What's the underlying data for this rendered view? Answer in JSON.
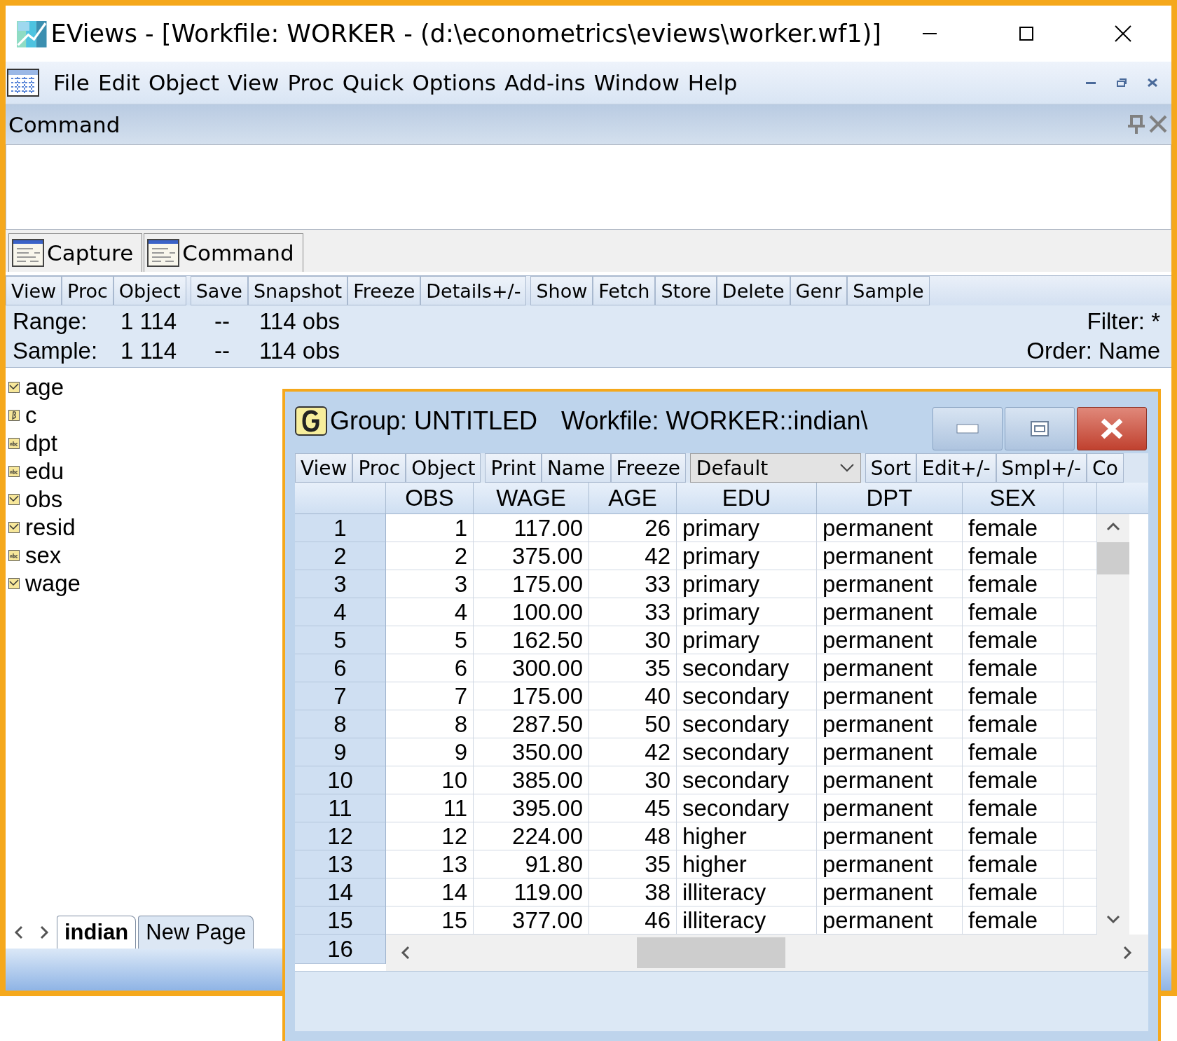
{
  "window": {
    "title": "EViews - [Workfile: WORKER - (d:\\econometrics\\eviews\\worker.wf1)]"
  },
  "menu": [
    "File",
    "Edit",
    "Object",
    "View",
    "Proc",
    "Quick",
    "Options",
    "Add-ins",
    "Window",
    "Help"
  ],
  "command_pane": {
    "title": "Command"
  },
  "pane_tabs": [
    {
      "label": "Capture"
    },
    {
      "label": "Command"
    }
  ],
  "workfile": {
    "toolbar": [
      [
        "View",
        "Proc",
        "Object"
      ],
      [
        "Save",
        "Snapshot",
        "Freeze",
        "Details+/-"
      ],
      [
        "Show",
        "Fetch",
        "Store",
        "Delete",
        "Genr",
        "Sample"
      ]
    ],
    "info": [
      {
        "label": "Range:",
        "start": "1 114",
        "sep": "--",
        "count": "114 obs",
        "right": "Filter: *"
      },
      {
        "label": "Sample:",
        "start": "1 114",
        "sep": "--",
        "count": "114 obs",
        "right": "Order: Name"
      }
    ],
    "objects": [
      {
        "name": "age",
        "kind": "series"
      },
      {
        "name": "c",
        "kind": "coef"
      },
      {
        "name": "dpt",
        "kind": "alpha"
      },
      {
        "name": "edu",
        "kind": "alpha"
      },
      {
        "name": "obs",
        "kind": "series"
      },
      {
        "name": "resid",
        "kind": "series"
      },
      {
        "name": "sex",
        "kind": "alpha"
      },
      {
        "name": "wage",
        "kind": "series"
      }
    ],
    "page_tabs": [
      {
        "label": "indian",
        "selected": true
      },
      {
        "label": "New Page",
        "selected": false
      }
    ]
  },
  "group_window": {
    "title": "Group: UNTITLED",
    "workfile": "Workfile: WORKER::indian\\",
    "toolbar": [
      [
        "View",
        "Proc",
        "Object"
      ],
      [
        "Print",
        "Name",
        "Freeze"
      ]
    ],
    "view_select": "Default",
    "toolbar_right": [
      "Sort",
      "Edit+/-",
      "Smpl+/-",
      "Co"
    ],
    "columns": [
      {
        "label": "OBS",
        "kind": "numeric"
      },
      {
        "label": "WAGE",
        "kind": "numeric"
      },
      {
        "label": "AGE",
        "kind": "numeric"
      },
      {
        "label": "EDU",
        "kind": "text"
      },
      {
        "label": "DPT",
        "kind": "text"
      },
      {
        "label": "SEX",
        "kind": "text"
      }
    ],
    "rows": [
      {
        "label": "1",
        "cells": [
          "1",
          "117.00",
          "26",
          "primary",
          "permanent",
          "female"
        ]
      },
      {
        "label": "2",
        "cells": [
          "2",
          "375.00",
          "42",
          "primary",
          "permanent",
          "female"
        ]
      },
      {
        "label": "3",
        "cells": [
          "3",
          "175.00",
          "33",
          "primary",
          "permanent",
          "female"
        ]
      },
      {
        "label": "4",
        "cells": [
          "4",
          "100.00",
          "33",
          "primary",
          "permanent",
          "female"
        ]
      },
      {
        "label": "5",
        "cells": [
          "5",
          "162.50",
          "30",
          "primary",
          "permanent",
          "female"
        ]
      },
      {
        "label": "6",
        "cells": [
          "6",
          "300.00",
          "35",
          "secondary",
          "permanent",
          "female"
        ]
      },
      {
        "label": "7",
        "cells": [
          "7",
          "175.00",
          "40",
          "secondary",
          "permanent",
          "female"
        ]
      },
      {
        "label": "8",
        "cells": [
          "8",
          "287.50",
          "50",
          "secondary",
          "permanent",
          "female"
        ]
      },
      {
        "label": "9",
        "cells": [
          "9",
          "350.00",
          "42",
          "secondary",
          "permanent",
          "female"
        ]
      },
      {
        "label": "10",
        "cells": [
          "10",
          "385.00",
          "30",
          "secondary",
          "permanent",
          "female"
        ]
      },
      {
        "label": "11",
        "cells": [
          "11",
          "395.00",
          "45",
          "secondary",
          "permanent",
          "female"
        ]
      },
      {
        "label": "12",
        "cells": [
          "12",
          "224.00",
          "48",
          "higher",
          "permanent",
          "female"
        ]
      },
      {
        "label": "13",
        "cells": [
          "13",
          "91.80",
          "35",
          "higher",
          "permanent",
          "female"
        ]
      },
      {
        "label": "14",
        "cells": [
          "14",
          "119.00",
          "38",
          "illiteracy",
          "permanent",
          "female"
        ]
      },
      {
        "label": "15",
        "cells": [
          "15",
          "377.00",
          "46",
          "illiteracy",
          "permanent",
          "female"
        ]
      }
    ],
    "partial_row": "16"
  }
}
